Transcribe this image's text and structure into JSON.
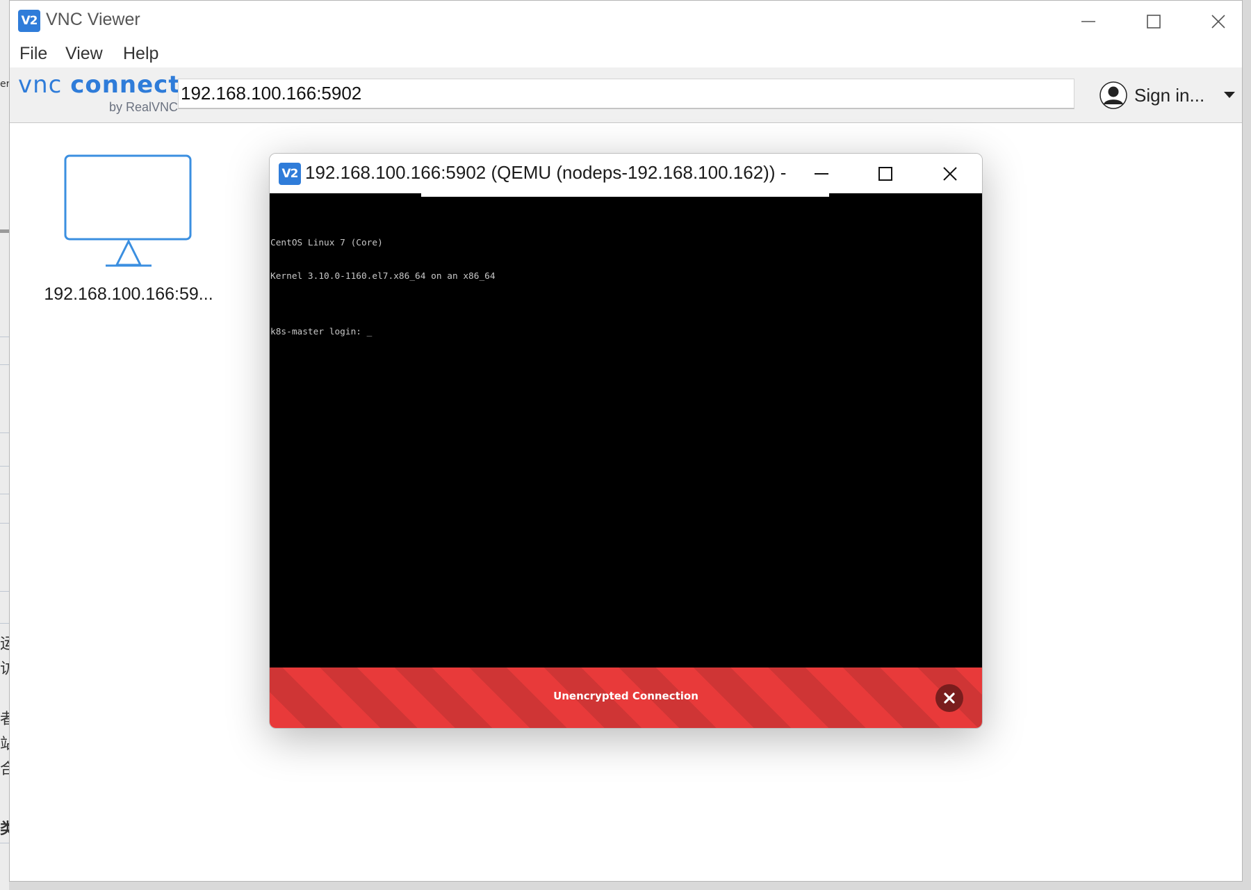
{
  "desktop": {
    "glyphs": [
      "ere",
      "运",
      "访",
      "者",
      "站",
      "合",
      "类"
    ]
  },
  "window": {
    "title": "VNC Viewer",
    "logo_text": "V2"
  },
  "menu": {
    "file": "File",
    "view": "View",
    "help": "Help"
  },
  "toolbar": {
    "brand_main_a": "vnc",
    "brand_main_b": "connect",
    "brand_sub": "by RealVNC",
    "address_value": "192.168.100.166:5902",
    "signin_label": "Sign in..."
  },
  "connections": [
    {
      "label": "192.168.100.166:59..."
    }
  ],
  "session": {
    "title": "192.168.100.166:5902 (QEMU (nodeps-192.168.100.162)) - ...",
    "logo_text": "V2",
    "console_lines": [
      "CentOS Linux 7 (Core)",
      "Kernel 3.10.0-1160.el7.x86_64 on an x86_64",
      "",
      "k8s-master login: _"
    ],
    "banner_text": "Unencrypted Connection"
  },
  "colors": {
    "brand_blue": "#2f7cd9",
    "banner_red": "#e83a3a",
    "banner_red_dark": "#cf3535",
    "close_badge": "#7a1d1d"
  }
}
